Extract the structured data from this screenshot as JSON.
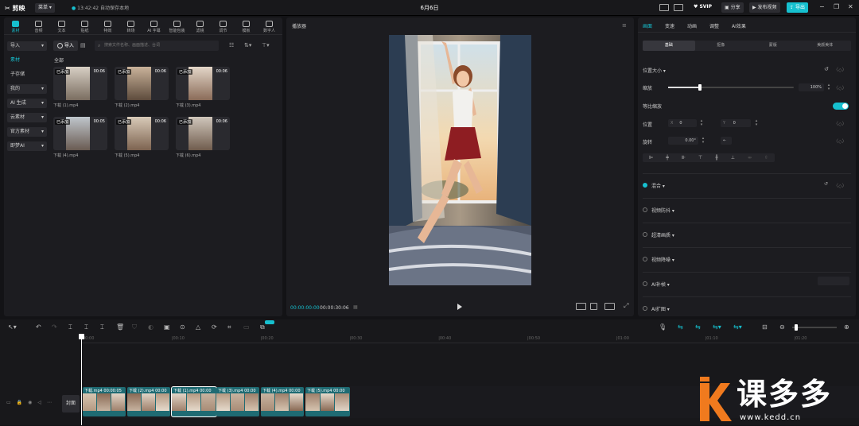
{
  "app": {
    "name": "剪映",
    "menu_label": "菜单",
    "save_status": "13:42:42 自动保存本地",
    "project_title": "6月6日"
  },
  "topbar": {
    "svip": "SVIP",
    "share": "分享",
    "publish": "发布视频",
    "export": "导出"
  },
  "media_tabs": [
    {
      "label": "素材",
      "icon": "media-icon",
      "active": true
    },
    {
      "label": "音频",
      "icon": "audio-icon"
    },
    {
      "label": "文本",
      "icon": "text-icon"
    },
    {
      "label": "贴纸",
      "icon": "sticker-icon"
    },
    {
      "label": "特效",
      "icon": "effects-icon"
    },
    {
      "label": "转场",
      "icon": "transition-icon"
    },
    {
      "label": "AI 字幕",
      "icon": "ai-caption-icon"
    },
    {
      "label": "智能包装",
      "icon": "smart-pack-icon"
    },
    {
      "label": "滤镜",
      "icon": "filter-icon"
    },
    {
      "label": "调节",
      "icon": "adjust-icon"
    },
    {
      "label": "模板",
      "icon": "template-icon"
    },
    {
      "label": "数字人",
      "icon": "avatar-icon"
    }
  ],
  "media_sidebar": [
    {
      "label": "导入",
      "arrow": "▾",
      "style": "box"
    },
    {
      "label": "素材",
      "style": "hl"
    },
    {
      "label": "子存储",
      "style": ""
    },
    {
      "label": "我的",
      "arrow": "▾",
      "style": "box"
    },
    {
      "label": "AI 生成",
      "arrow": "▾",
      "style": "box"
    },
    {
      "label": "云素材",
      "arrow": "▾",
      "style": "box"
    },
    {
      "label": "官方素材",
      "arrow": "▾",
      "style": "box"
    },
    {
      "label": "即梦AI",
      "arrow": "▾",
      "style": "box"
    }
  ],
  "media_toolbar": {
    "import": "导入",
    "search_placeholder": "搜索文件名称、画面描述、台词"
  },
  "media_section": "全部",
  "media_items": [
    {
      "badge": "已添加",
      "duration": "00:06",
      "name": "下载 (1).mp4"
    },
    {
      "badge": "已添加",
      "duration": "00:06",
      "name": "下载 (2).mp4"
    },
    {
      "badge": "已添加",
      "duration": "00:06",
      "name": "下载 (3).mp4"
    },
    {
      "badge": "已添加",
      "duration": "00:05",
      "name": "下载 (4).mp4"
    },
    {
      "badge": "已添加",
      "duration": "00:06",
      "name": "下载 (5).mp4"
    },
    {
      "badge": "已添加",
      "duration": "00:06",
      "name": "下载 (6).mp4"
    }
  ],
  "player": {
    "title": "播放器",
    "current_time": "00:00:00:00",
    "total_time": "00:00:30:06"
  },
  "props": {
    "tabs": [
      "画面",
      "变速",
      "动画",
      "调整",
      "AI效果"
    ],
    "subtabs": [
      "基础",
      "抠像",
      "蒙版",
      "美颜美体"
    ],
    "position_size": "位置大小",
    "scale_label": "缩放",
    "scale_value": "100%",
    "scale_fraction": 0.25,
    "uniform_scale": "等比缩放",
    "position_label": "位置",
    "pos_x_label": "X",
    "pos_x": "0",
    "pos_y_label": "Y",
    "pos_y": "0",
    "rotate_label": "旋转",
    "rotate_value": "0.00°",
    "sections": [
      {
        "label": "混合",
        "checked": true
      },
      {
        "label": "视频防抖",
        "checked": false
      },
      {
        "label": "超清画质",
        "checked": false
      },
      {
        "label": "视频降噪",
        "checked": false
      },
      {
        "label": "AI补帧",
        "checked": false
      },
      {
        "label": "AI扩图",
        "checked": false
      }
    ]
  },
  "timeline": {
    "ticks": [
      "00:00",
      "|00:10",
      "|00:20",
      "|00:30",
      "|00:40",
      "|00:50",
      "|01:00",
      "|01:10",
      "|01:20"
    ],
    "cover_label": "封面",
    "clips": [
      {
        "label": "下载.mp4",
        "time": "00:00:05"
      },
      {
        "label": "下载 (2).mp4",
        "time": "00:00"
      },
      {
        "label": "下载 (1).mp4",
        "time": "00:00"
      },
      {
        "label": "下载 (3).mp4",
        "time": "00:00"
      },
      {
        "label": "下载 (4).mp4",
        "time": "00:00"
      },
      {
        "label": "下载 (5).mp4",
        "time": "00:00"
      }
    ]
  },
  "watermark": {
    "brand": "课多多",
    "url": "www.kedd.cn"
  },
  "colors": {
    "accent": "#16c0cf",
    "panel": "#1c1c20",
    "clip": "#1f6b73"
  }
}
